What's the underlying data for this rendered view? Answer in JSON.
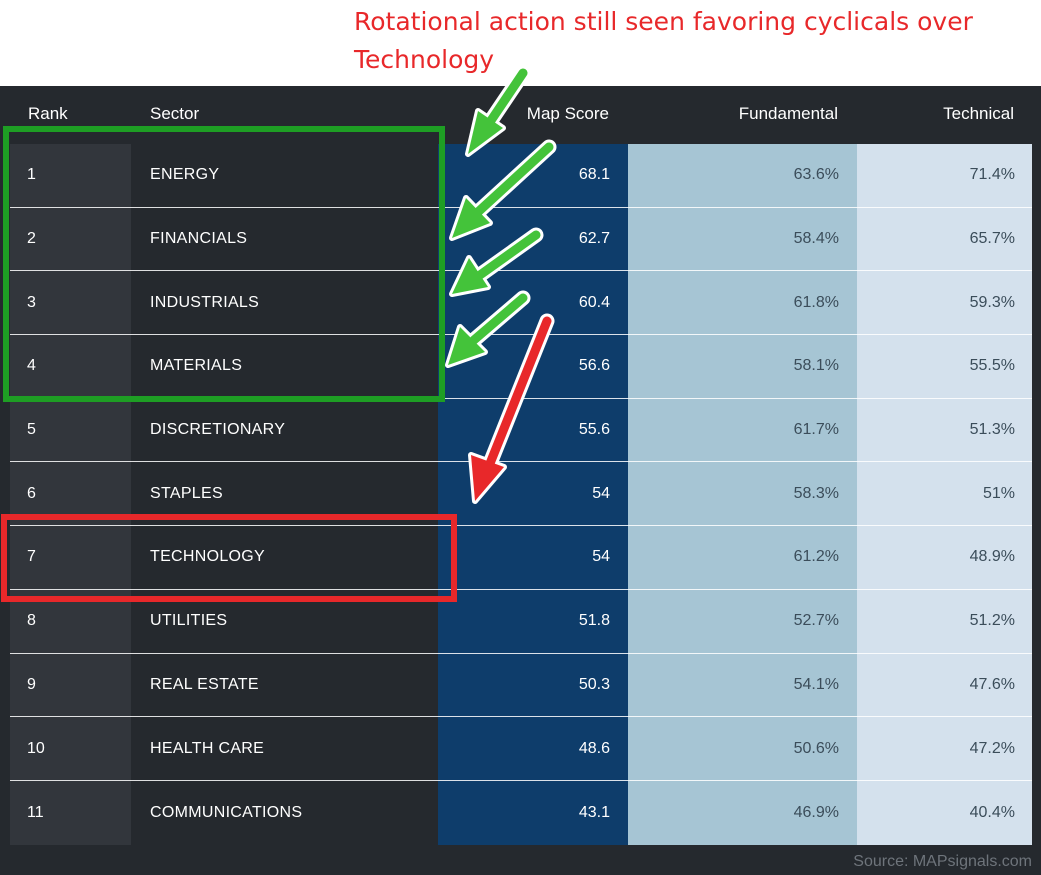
{
  "annotation": {
    "line1": "Rotational action still seen favoring cyclicals over",
    "line2": "Technology"
  },
  "table": {
    "columns": {
      "rank": "Rank",
      "sector": "Sector",
      "map_score": "Map Score",
      "fundamental": "Fundamental",
      "technical": "Technical"
    },
    "rows": [
      {
        "rank": "1",
        "sector": "ENERGY",
        "map_score": "68.1",
        "fundamental": "63.6%",
        "technical": "71.4%"
      },
      {
        "rank": "2",
        "sector": "FINANCIALS",
        "map_score": "62.7",
        "fundamental": "58.4%",
        "technical": "65.7%"
      },
      {
        "rank": "3",
        "sector": "INDUSTRIALS",
        "map_score": "60.4",
        "fundamental": "61.8%",
        "technical": "59.3%"
      },
      {
        "rank": "4",
        "sector": "MATERIALS",
        "map_score": "56.6",
        "fundamental": "58.1%",
        "technical": "55.5%"
      },
      {
        "rank": "5",
        "sector": "DISCRETIONARY",
        "map_score": "55.6",
        "fundamental": "61.7%",
        "technical": "51.3%"
      },
      {
        "rank": "6",
        "sector": "STAPLES",
        "map_score": "54",
        "fundamental": "58.3%",
        "technical": "51%"
      },
      {
        "rank": "7",
        "sector": "TECHNOLOGY",
        "map_score": "54",
        "fundamental": "61.2%",
        "technical": "48.9%"
      },
      {
        "rank": "8",
        "sector": "UTILITIES",
        "map_score": "51.8",
        "fundamental": "52.7%",
        "technical": "51.2%"
      },
      {
        "rank": "9",
        "sector": "REAL ESTATE",
        "map_score": "50.3",
        "fundamental": "54.1%",
        "technical": "47.6%"
      },
      {
        "rank": "10",
        "sector": "HEALTH CARE",
        "map_score": "48.6",
        "fundamental": "50.6%",
        "technical": "47.2%"
      },
      {
        "rank": "11",
        "sector": "COMMUNICATIONS",
        "map_score": "43.1",
        "fundamental": "46.9%",
        "technical": "40.4%"
      }
    ]
  },
  "source": "Source: MAPsignals.com",
  "colors": {
    "panel": "#25292e",
    "rank_column": "#32363c",
    "map_score_column": "#0e3d6b",
    "fundamental_column": "#a6c5d4",
    "technical_column": "#d4e1ed",
    "highlight_green": "#1e9e24",
    "highlight_red": "#e8282a",
    "arrow_green": "#44c33a",
    "arrow_red": "#e8282a"
  },
  "icons": [
    "green-arrow-icon",
    "red-arrow-icon"
  ]
}
